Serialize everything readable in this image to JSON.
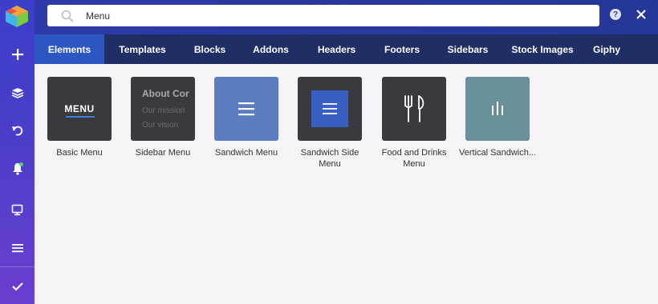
{
  "search": {
    "value": "Menu",
    "placeholder": ""
  },
  "topbar": {
    "help_label": "?"
  },
  "tabs": [
    {
      "label": "Elements",
      "active": true
    },
    {
      "label": "Templates",
      "active": false
    },
    {
      "label": "Blocks",
      "active": false
    },
    {
      "label": "Addons",
      "active": false
    },
    {
      "label": "Headers",
      "active": false
    },
    {
      "label": "Footers",
      "active": false
    },
    {
      "label": "Sidebars",
      "active": false
    },
    {
      "label": "Stock Images",
      "active": false
    },
    {
      "label": "Giphy",
      "active": false
    }
  ],
  "sidebar_rail": {
    "items": [
      "logo-icon",
      "add-icon",
      "layers-icon",
      "undo-icon",
      "notifications-icon",
      "preview-icon",
      "menu-icon",
      "check-icon"
    ]
  },
  "elements": [
    {
      "label": "Basic Menu",
      "thumb_text": "MENU"
    },
    {
      "label": "Sidebar Menu",
      "thumb_title": "About Cor",
      "thumb_line1": "Our mission",
      "thumb_line2": "Our vision"
    },
    {
      "label": "Sandwich Menu"
    },
    {
      "label": "Sandwich Side Menu"
    },
    {
      "label": "Food and Drinks Menu"
    },
    {
      "label": "Vertical Sandwich..."
    }
  ],
  "colors": {
    "rail_top": "#3a3fc9",
    "rail_bottom": "#6a3ed0",
    "topbar": "#2d3aa8",
    "tabbar": "#1f2f66",
    "tab_active": "#2c56c2",
    "notification_dot": "#4cd964"
  }
}
